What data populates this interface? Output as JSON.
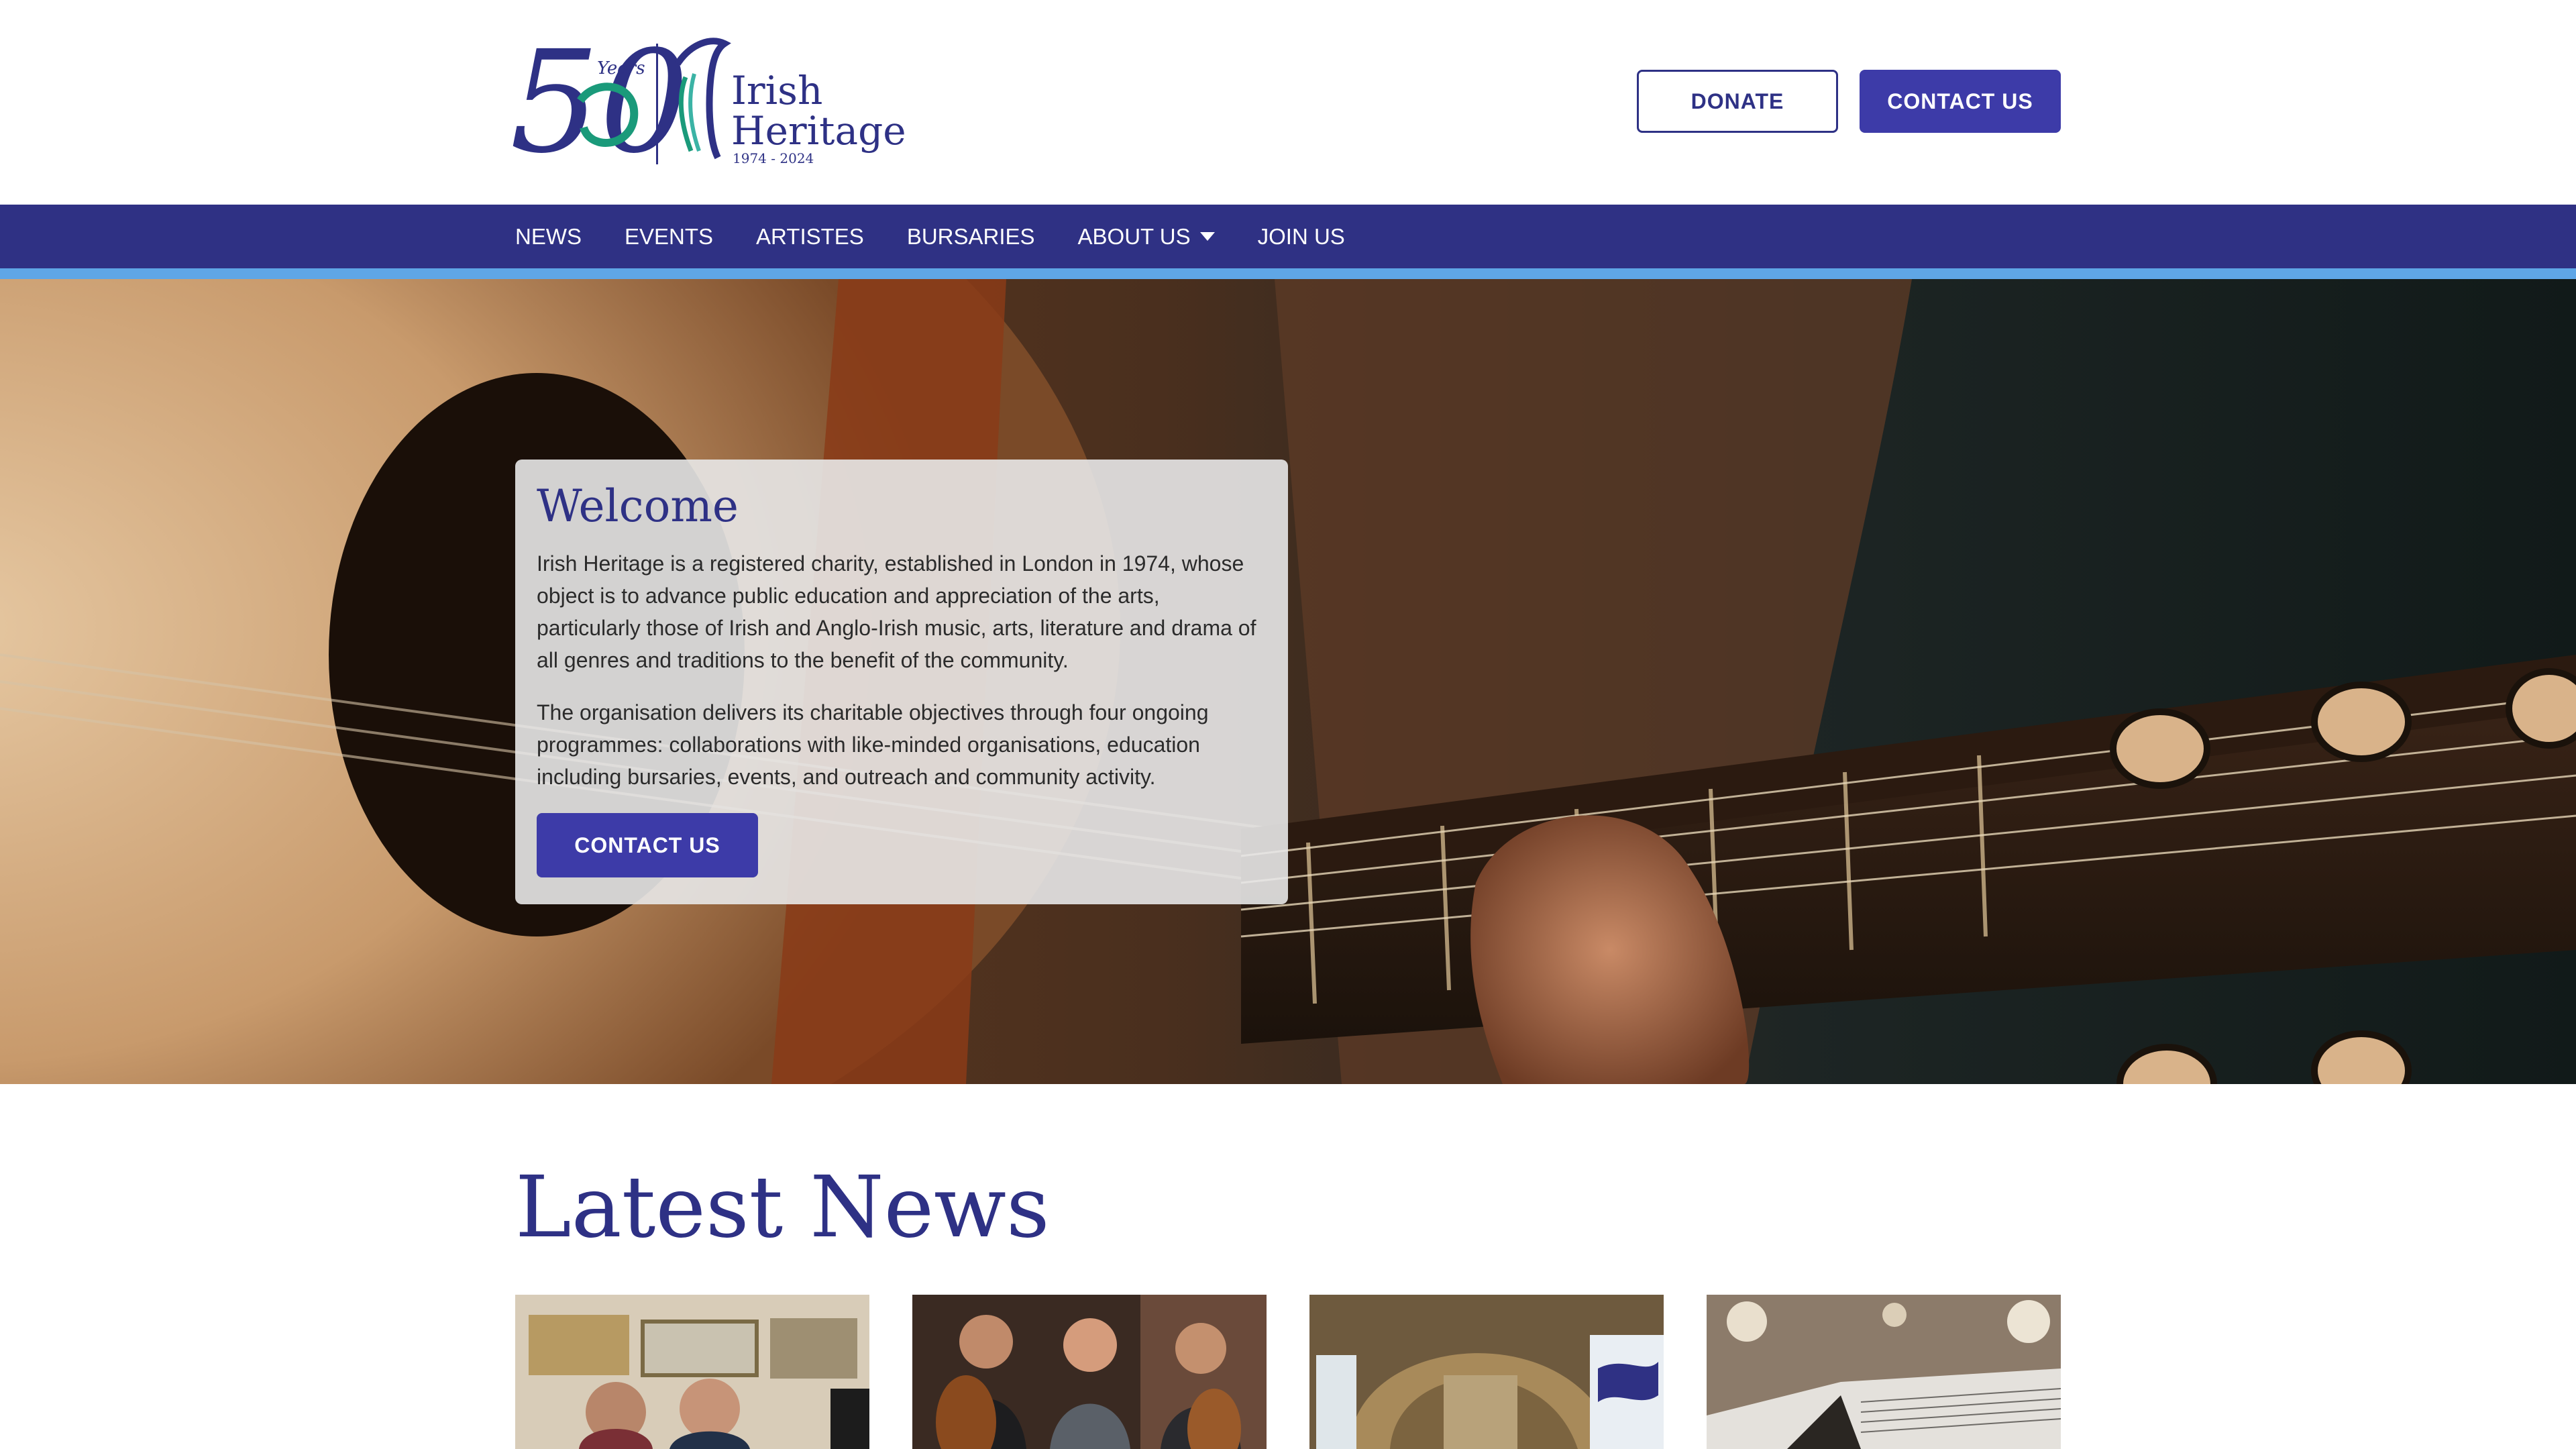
{
  "header": {
    "logo": {
      "years_number": "50",
      "years_label": "Years",
      "name_line1": "Irish",
      "name_line2": "Heritage",
      "dates": "1974 - 2024"
    },
    "donate_label": "DONATE",
    "contact_label": "CONTACT US"
  },
  "nav": {
    "items": [
      {
        "label": "NEWS"
      },
      {
        "label": "EVENTS"
      },
      {
        "label": "ARTISTES"
      },
      {
        "label": "BURSARIES"
      },
      {
        "label": "ABOUT US",
        "has_dropdown": true
      },
      {
        "label": "JOIN US"
      }
    ]
  },
  "hero": {
    "title": "Welcome",
    "paragraph1": "Irish Heritage is a registered charity, established in London in 1974, whose object is to advance public education and appreciation of the arts, particularly those of Irish and Anglo-Irish music, arts, literature and drama of all genres and traditions to the benefit of the community.",
    "paragraph2": "The organisation delivers its charitable objectives through four ongoing programmes: collaborations with like-minded organisations, education including bursaries, events, and outreach and community activity.",
    "button_label": "CONTACT US"
  },
  "news": {
    "title": "Latest News"
  },
  "colors": {
    "brand_navy": "#2f3184",
    "brand_button": "#3d3ba8",
    "nav_accent": "#5fa6e6",
    "logo_green": "#1a9a7a"
  },
  "icons": {
    "dropdown": "caret-down-icon"
  }
}
